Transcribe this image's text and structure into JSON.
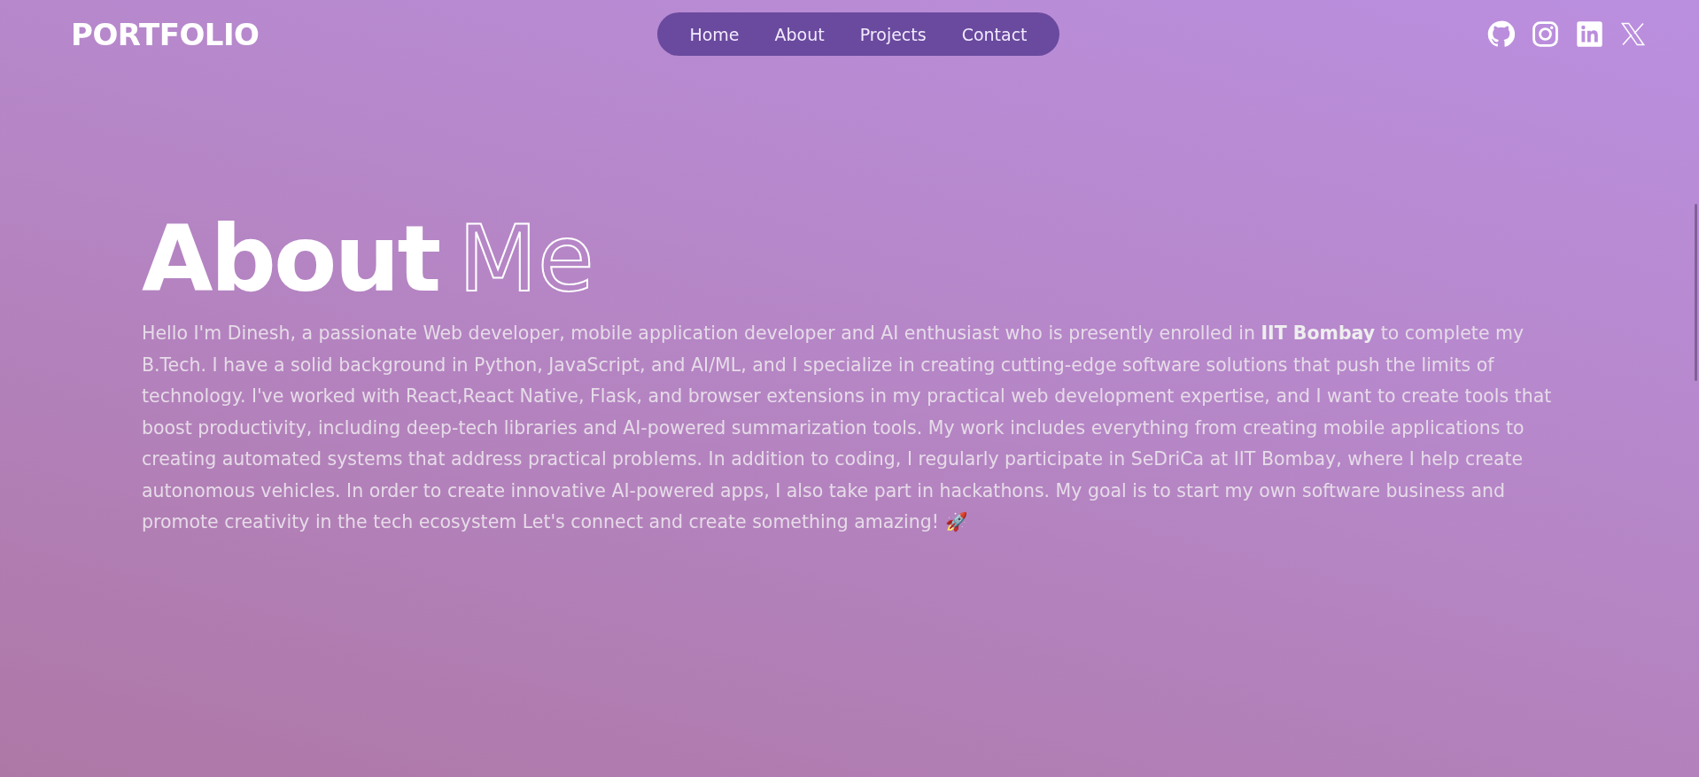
{
  "logo": "PORTFOLIO",
  "nav": [
    {
      "label": "Home"
    },
    {
      "label": "About"
    },
    {
      "label": "Projects"
    },
    {
      "label": "Contact"
    }
  ],
  "social": [
    {
      "kind": "github"
    },
    {
      "kind": "instagram"
    },
    {
      "kind": "linkedin"
    },
    {
      "kind": "x"
    }
  ],
  "heading": {
    "solid": "About",
    "outline": "Me"
  },
  "paragraph": "Hello I'm Dinesh, a passionate Web developer, mobile application developer and AI enthusiast who is presently enrolled in **IIT Bombay** to complete my B.Tech. I have a solid background in Python, JavaScript, and AI/ML, and I specialize in creating cutting-edge software solutions that push the limits of technology. I've worked with React,React Native, Flask, and browser extensions in my practical web development expertise, and I want to create tools that boost productivity, including deep-tech libraries and AI-powered summarization tools. My work includes everything from creating mobile applications to creating automated systems that address practical problems. In addition to coding, I regularly participate in SeDriCa at IIT Bombay, where I help create autonomous vehicles. In order to create innovative AI-powered apps, I also take part in hackathons. My goal is to start my own software business and promote creativity in the tech ecosystem Let's connect and create something amazing! 🚀"
}
